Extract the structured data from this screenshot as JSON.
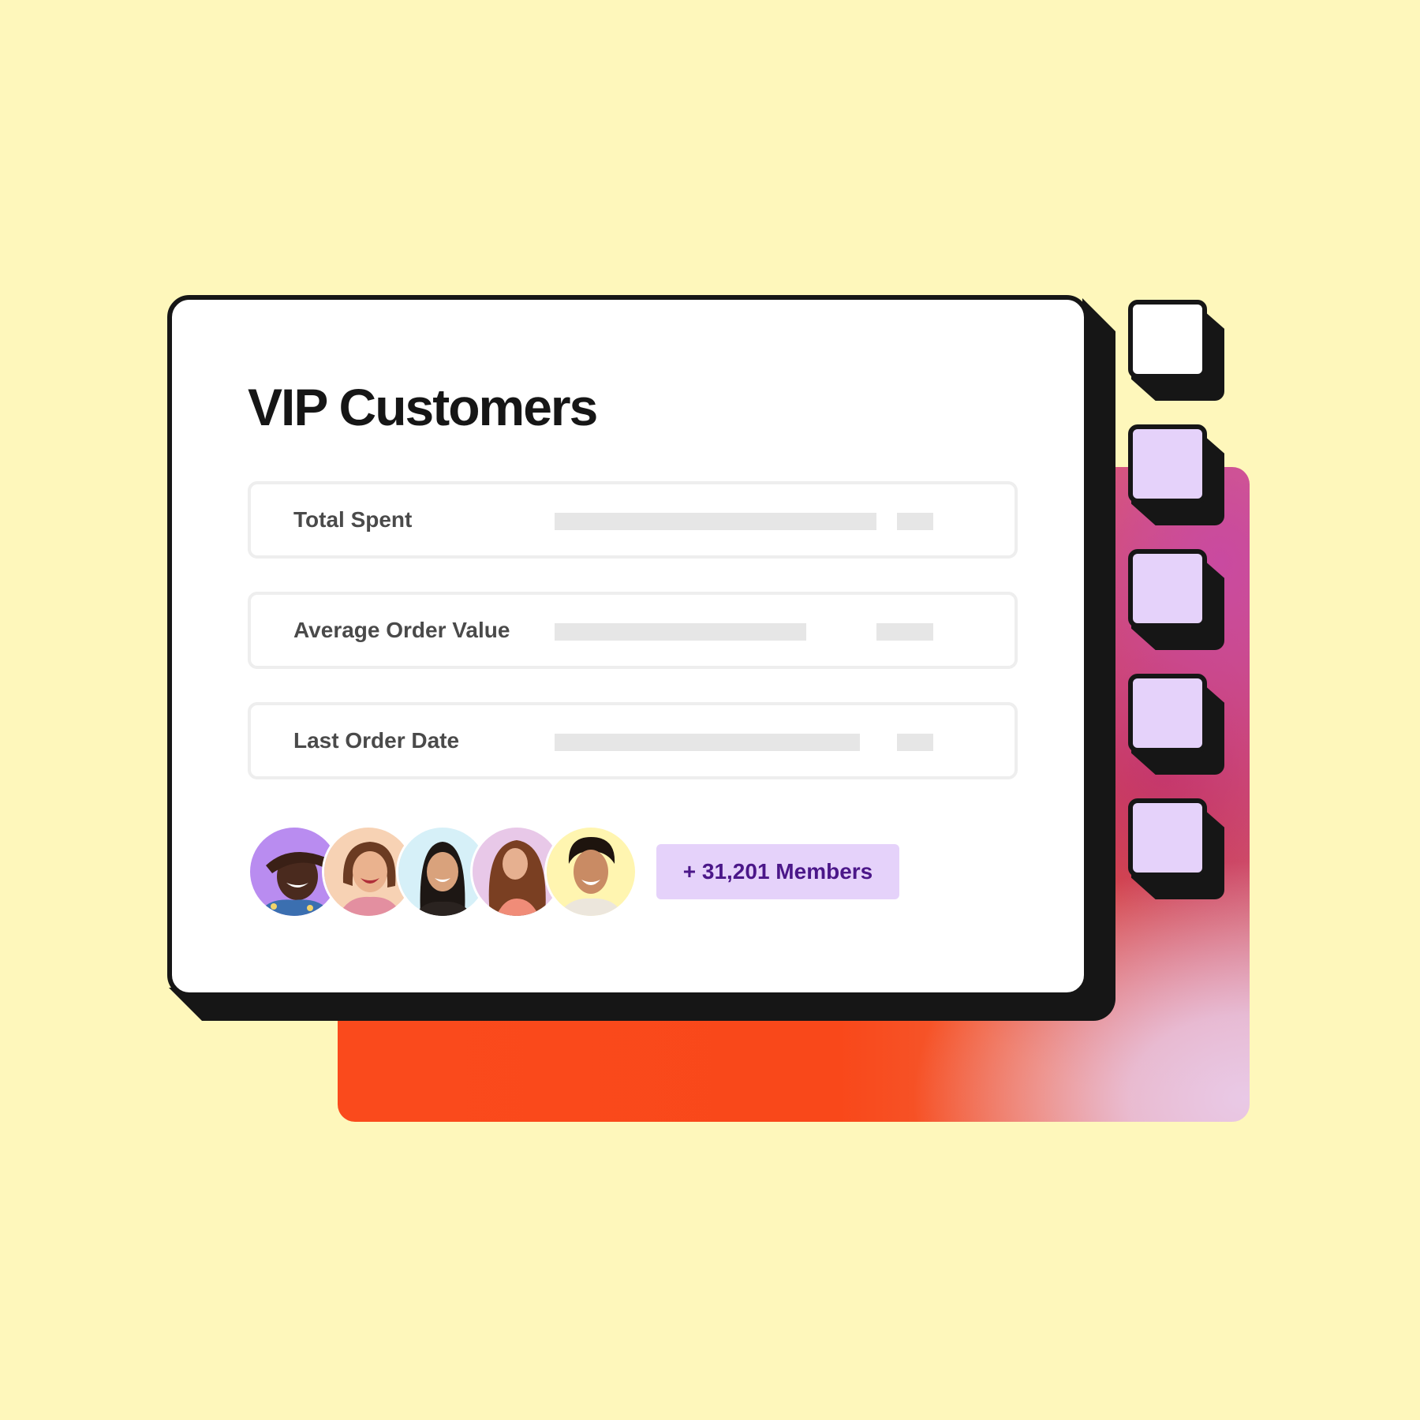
{
  "card": {
    "title": "VIP Customers"
  },
  "filters": [
    {
      "label": "Total Spent"
    },
    {
      "label": "Average Order Value"
    },
    {
      "label": "Last Order Date"
    }
  ],
  "members": {
    "badge_label": "+ 31,201 Members",
    "avatar_count": 5,
    "avatar_backgrounds": [
      "#b98cf0",
      "#f7d2b4",
      "#d6f0f8",
      "#e8c8e8",
      "#fff5b0"
    ]
  },
  "side_squares": {
    "count": 5,
    "colors": [
      "#ffffff",
      "#e5d2fa",
      "#e5d2fa",
      "#e5d2fa",
      "#e5d2fa"
    ]
  },
  "colors": {
    "background": "#fef7bb",
    "ink": "#161616",
    "badge_bg": "#e5d2fa",
    "badge_text": "#4b1789",
    "gradient_orange": "#fa4a1c",
    "gradient_magenta": "#c94aa0"
  }
}
